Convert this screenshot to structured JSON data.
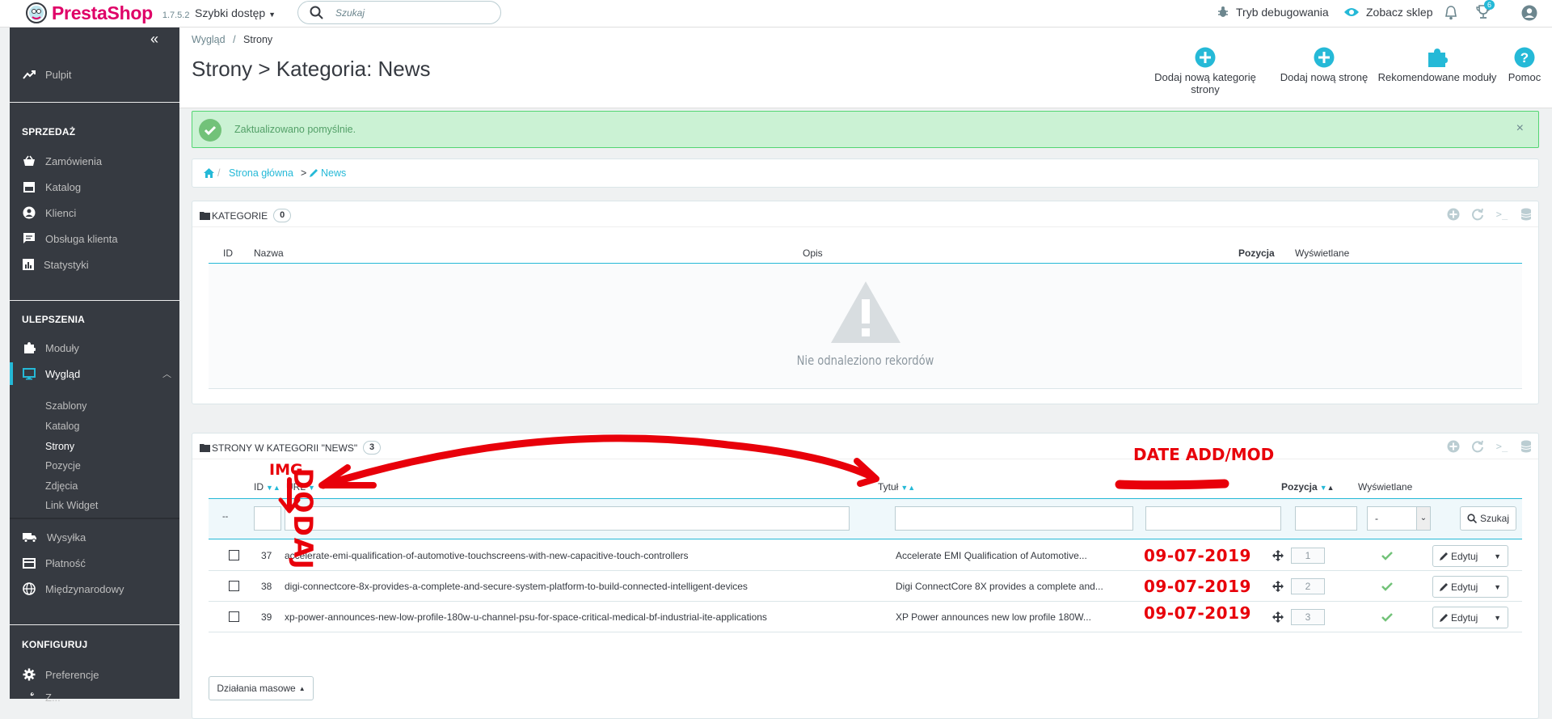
{
  "topbar": {
    "logo_text": "PrestaShop",
    "version": "1.7.5.2",
    "quick_access": "Szybki dostęp",
    "search_placeholder": "Szukaj",
    "debug": "Tryb debugowania",
    "view_shop": "Zobacz sklep",
    "trophy_count": "6"
  },
  "sidebar": {
    "dashboard": "Pulpit",
    "section_sell": "SPRZEDAŻ",
    "orders": "Zamówienia",
    "catalog": "Katalog",
    "customers": "Klienci",
    "service": "Obsługa klienta",
    "stats": "Statystyki",
    "section_improve": "ULEPSZENIA",
    "modules": "Moduły",
    "design": "Wygląd",
    "design_sub": [
      "Szablony",
      "Katalog",
      "Strony",
      "Pozycje",
      "Zdjęcia",
      "Link Widget"
    ],
    "shipping": "Wysyłka",
    "payment": "Płatność",
    "international": "Międzynarodowy",
    "section_configure": "KONFIGURUJ",
    "preferences": "Preferencje",
    "next_item": "Z..."
  },
  "header": {
    "breadcrumb_parent": "Wygląd",
    "breadcrumb_sep": "/",
    "breadcrumb_current": "Strony",
    "title": "Strony > Kategoria: News",
    "toolbar": [
      {
        "label": "Dodaj nową kategorię strony",
        "icon": "plus-circle-icon"
      },
      {
        "label": "Dodaj nową stronę",
        "icon": "plus-circle-icon"
      },
      {
        "label": "Rekomendowane moduły",
        "icon": "puzzle-icon"
      },
      {
        "label": "Pomoc",
        "icon": "help-icon"
      }
    ]
  },
  "alert": {
    "text": "Zaktualizowano pomyślnie.",
    "close": "×"
  },
  "cat_breadcrumb": {
    "home": "Strona główna",
    "sep": ">",
    "current": "News"
  },
  "categories": {
    "title": "KATEGORIE",
    "count": "0",
    "columns": [
      "ID",
      "Nazwa",
      "Opis",
      "Pozycja",
      "Wyświetlane"
    ],
    "empty": "Nie odnaleziono rekordów"
  },
  "pages": {
    "title": "STRONY W KATEGORII \"NEWS\"",
    "count": "3",
    "columns": {
      "id": "ID",
      "url": "URL",
      "title": "Tytuł",
      "position": "Pozycja",
      "displayed": "Wyświetlane"
    },
    "filter_dash": "--",
    "filter_select": "-",
    "search_button": "Szukaj",
    "rows": [
      {
        "id": "37",
        "url": "accelerate-emi-qualification-of-automotive-touchscreens-with-new-capacitive-touch-controllers",
        "title": "Accelerate EMI Qualification of Automotive...",
        "date": "09-07-2019",
        "position": "1",
        "edit": "Edytuj"
      },
      {
        "id": "38",
        "url": "digi-connectcore-8x-provides-a-complete-and-secure-system-platform-to-build-connected-intelligent-devices",
        "title": "Digi ConnectCore 8X provides a complete and...",
        "date": "09-07-2019",
        "position": "2",
        "edit": "Edytuj"
      },
      {
        "id": "39",
        "url": "xp-power-announces-new-low-profile-180w-u-channel-psu-for-space-critical-medical-bf-industrial-ite-applications",
        "title": "XP Power announces new low profile 180W...",
        "date": "09-07-2019",
        "position": "3",
        "edit": "Edytuj"
      }
    ],
    "bulk": "Działania masowe"
  },
  "annotations": {
    "img": "IMG",
    "date": "DATE ADD/MOD",
    "vertical": "DODAJ"
  },
  "colors": {
    "brand": "#df0067",
    "accent": "#25b9d7",
    "sidebar": "#363a41",
    "annotation": "#e8000a",
    "success": "#72c279"
  }
}
